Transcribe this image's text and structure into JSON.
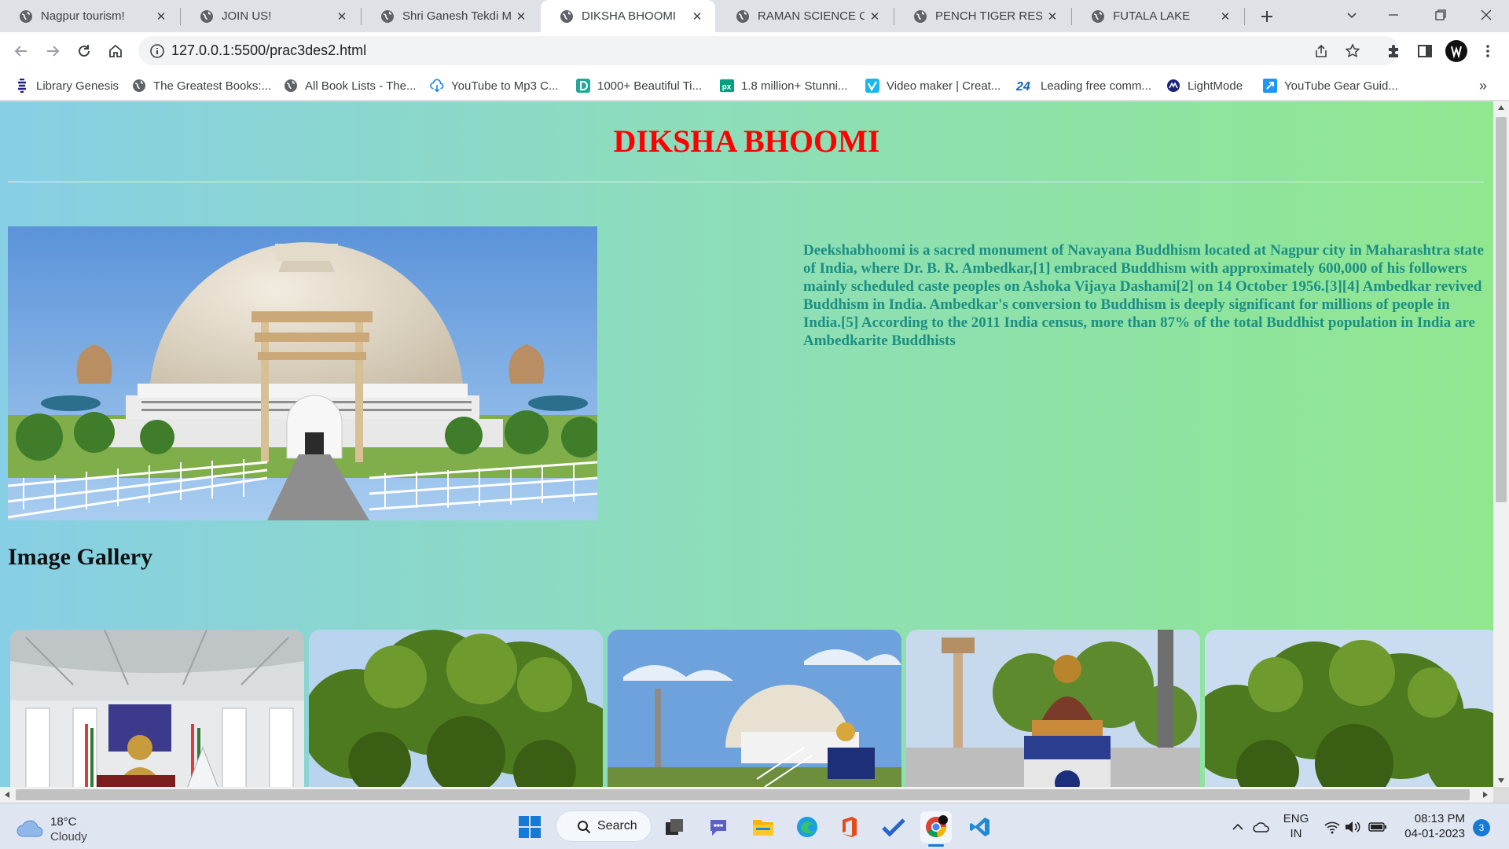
{
  "browser": {
    "tabs": [
      {
        "title": "Nagpur tourism!",
        "active": false
      },
      {
        "title": "JOIN US!",
        "active": false
      },
      {
        "title": "Shri Ganesh Tekdi Ma",
        "active": false
      },
      {
        "title": "DIKSHA BHOOMI",
        "active": true
      },
      {
        "title": "RAMAN SCIENCE CEN",
        "active": false
      },
      {
        "title": "PENCH TIGER RESERV",
        "active": false
      },
      {
        "title": "FUTALA LAKE",
        "active": false
      }
    ],
    "url": "127.0.0.1:5500/prac3des2.html",
    "bookmarks": [
      {
        "label": "Library Genesis",
        "icon": "library-genesis-icon"
      },
      {
        "label": "The Greatest Books:...",
        "icon": "globe-icon"
      },
      {
        "label": "All Book Lists - The...",
        "icon": "globe-icon"
      },
      {
        "label": "YouTube to Mp3 C...",
        "icon": "download-cloud-icon"
      },
      {
        "label": "1000+ Beautiful Ti...",
        "icon": "d-letter-icon"
      },
      {
        "label": "1.8 million+ Stunni...",
        "icon": "px-icon"
      },
      {
        "label": "Video maker | Creat...",
        "icon": "vimeo-v-icon"
      },
      {
        "label": "Leading free comm...",
        "icon": "number-24-icon"
      },
      {
        "label": "LightMode",
        "icon": "lightmode-icon"
      },
      {
        "label": "YouTube Gear Guid...",
        "icon": "kit-icon"
      }
    ]
  },
  "page": {
    "title": "DIKSHA BHOOMI",
    "description": "Deekshabhoomi is a sacred monument of Navayana Buddhism located at Nagpur city in Maharashtra state of India, where Dr. B. R. Ambedkar,[1] embraced Buddhism with approximately 600,000 of his followers mainly scheduled caste peoples on Ashoka Vijaya Dashami[2] on 14 October 1956.[3][4] Ambedkar revived Buddhism in India. Ambedkar's conversion to Buddhism is deeply significant for millions of people in India.[5] According to the 2011 India census, more than 87% of the total Buddhist population in India are Ambedkarite Buddhists",
    "gallery_heading": "Image Gallery",
    "gallery_count": 5
  },
  "taskbar": {
    "weather_temp": "18°C",
    "weather_cond": "Cloudy",
    "search_label": "Search",
    "lang_top": "ENG",
    "lang_bottom": "IN",
    "time": "08:13 PM",
    "date": "04-01-2023",
    "notifications": "3"
  },
  "colors": {
    "title": "#ff0000",
    "description": "#1c8f84",
    "gradient_start": "#87cfe5",
    "gradient_end": "#90e78f"
  }
}
